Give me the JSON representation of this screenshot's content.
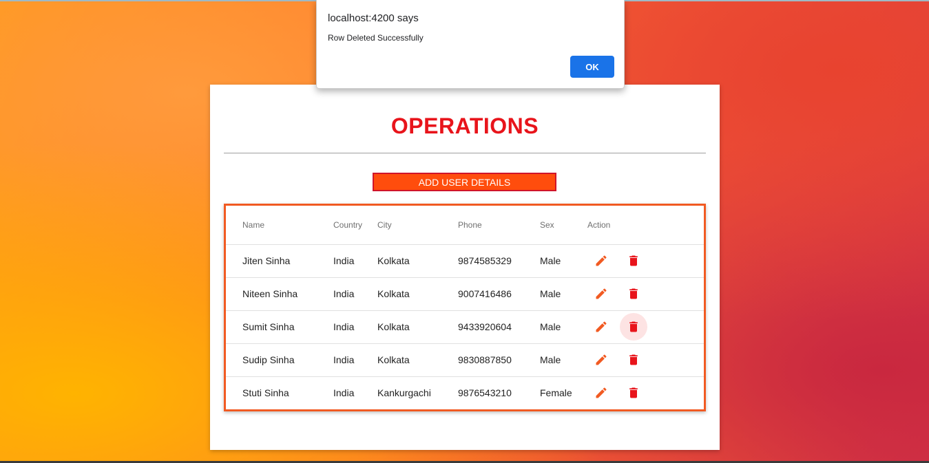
{
  "dialog": {
    "title": "localhost:4200 says",
    "message": "Row Deleted Successfully",
    "ok_label": "OK"
  },
  "page": {
    "title": "OPERATIONS",
    "add_button_label": "ADD USER DETAILS"
  },
  "table": {
    "columns": [
      "Name",
      "Country",
      "City",
      "Phone",
      "Sex",
      "Action"
    ],
    "rows": [
      {
        "name": "Jiten Sinha",
        "country": "India",
        "city": "Kolkata",
        "phone": "9874585329",
        "sex": "Male"
      },
      {
        "name": "Niteen Sinha",
        "country": "India",
        "city": "Kolkata",
        "phone": "9007416486",
        "sex": "Male"
      },
      {
        "name": "Sumit Sinha",
        "country": "India",
        "city": "Kolkata",
        "phone": "9433920604",
        "sex": "Male"
      },
      {
        "name": "Sudip Sinha",
        "country": "India",
        "city": "Kolkata",
        "phone": "9830887850",
        "sex": "Male"
      },
      {
        "name": "Stuti Sinha",
        "country": "India",
        "city": "Kankurgachi",
        "phone": "9876543210",
        "sex": "Female"
      }
    ]
  },
  "icons": {
    "edit": "edit-icon",
    "delete": "delete-icon"
  },
  "colors": {
    "title": "#e8141b",
    "add_button_bg": "#ff4d0d",
    "table_border": "#f15a22",
    "edit_icon": "#f15a22",
    "delete_icon": "#e8141b",
    "ok_button": "#1a73e8"
  }
}
